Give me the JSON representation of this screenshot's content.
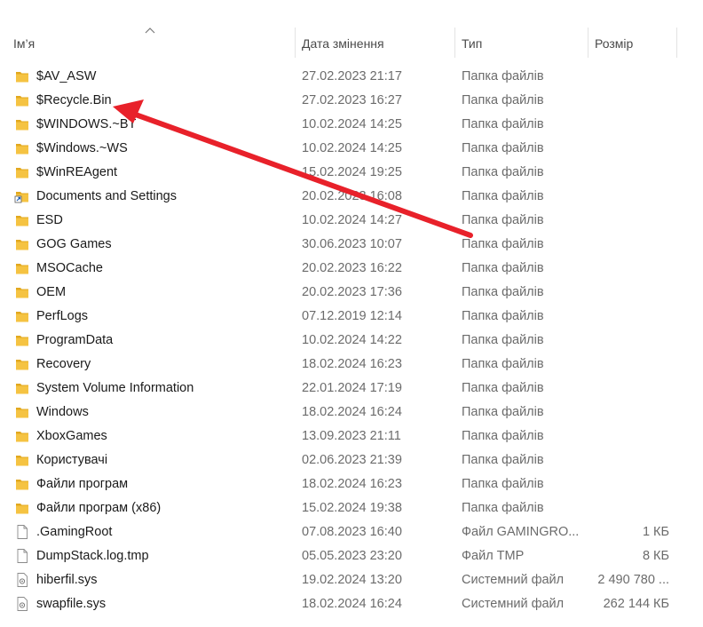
{
  "columns": {
    "name": "Ім’я",
    "date": "Дата змінення",
    "type": "Тип",
    "size": "Розмір"
  },
  "rows": [
    {
      "name": "$AV_ASW",
      "date": "27.02.2023 21:17",
      "type": "Папка файлів",
      "size": "",
      "icon": "folder-icon"
    },
    {
      "name": "$Recycle.Bin",
      "date": "27.02.2023 16:27",
      "type": "Папка файлів",
      "size": "",
      "icon": "folder-icon"
    },
    {
      "name": "$WINDOWS.~BT",
      "date": "10.02.2024 14:25",
      "type": "Папка файлів",
      "size": "",
      "icon": "folder-icon"
    },
    {
      "name": "$Windows.~WS",
      "date": "10.02.2024 14:25",
      "type": "Папка файлів",
      "size": "",
      "icon": "folder-icon"
    },
    {
      "name": "$WinREAgent",
      "date": "15.02.2024 19:25",
      "type": "Папка файлів",
      "size": "",
      "icon": "folder-icon"
    },
    {
      "name": "Documents and Settings",
      "date": "20.02.2023 16:08",
      "type": "Папка файлів",
      "size": "",
      "icon": "shortcut-folder-icon"
    },
    {
      "name": "ESD",
      "date": "10.02.2024 14:27",
      "type": "Папка файлів",
      "size": "",
      "icon": "folder-icon"
    },
    {
      "name": "GOG Games",
      "date": "30.06.2023 10:07",
      "type": "Папка файлів",
      "size": "",
      "icon": "folder-icon"
    },
    {
      "name": "MSOCache",
      "date": "20.02.2023 16:22",
      "type": "Папка файлів",
      "size": "",
      "icon": "folder-icon"
    },
    {
      "name": "OEM",
      "date": "20.02.2023 17:36",
      "type": "Папка файлів",
      "size": "",
      "icon": "folder-icon"
    },
    {
      "name": "PerfLogs",
      "date": "07.12.2019 12:14",
      "type": "Папка файлів",
      "size": "",
      "icon": "folder-icon"
    },
    {
      "name": "ProgramData",
      "date": "10.02.2024 14:22",
      "type": "Папка файлів",
      "size": "",
      "icon": "folder-icon"
    },
    {
      "name": "Recovery",
      "date": "18.02.2024 16:23",
      "type": "Папка файлів",
      "size": "",
      "icon": "folder-icon"
    },
    {
      "name": "System Volume Information",
      "date": "22.01.2024 17:19",
      "type": "Папка файлів",
      "size": "",
      "icon": "folder-icon"
    },
    {
      "name": "Windows",
      "date": "18.02.2024 16:24",
      "type": "Папка файлів",
      "size": "",
      "icon": "folder-icon"
    },
    {
      "name": "XboxGames",
      "date": "13.09.2023 21:11",
      "type": "Папка файлів",
      "size": "",
      "icon": "folder-icon"
    },
    {
      "name": "Користувачі",
      "date": "02.06.2023 21:39",
      "type": "Папка файлів",
      "size": "",
      "icon": "folder-icon"
    },
    {
      "name": "Файли програм",
      "date": "18.02.2024 16:23",
      "type": "Папка файлів",
      "size": "",
      "icon": "folder-icon"
    },
    {
      "name": "Файли програм (x86)",
      "date": "15.02.2024 19:38",
      "type": "Папка файлів",
      "size": "",
      "icon": "folder-icon"
    },
    {
      "name": ".GamingRoot",
      "date": "07.08.2023 16:40",
      "type": "Файл GAMINGRO...",
      "size": "1 КБ",
      "icon": "file-icon"
    },
    {
      "name": "DumpStack.log.tmp",
      "date": "05.05.2023 23:20",
      "type": "Файл TMP",
      "size": "8 КБ",
      "icon": "file-icon"
    },
    {
      "name": "hiberfil.sys",
      "date": "19.02.2024 13:20",
      "type": "Системний файл",
      "size": "2 490 780 ...",
      "icon": "system-file-icon"
    },
    {
      "name": "swapfile.sys",
      "date": "18.02.2024 16:24",
      "type": "Системний файл",
      "size": "262 144 КБ",
      "icon": "system-file-icon"
    }
  ],
  "colors": {
    "folder": "#f5c342",
    "folder_dark": "#e2a81f",
    "annotation_arrow": "#e8212a"
  }
}
